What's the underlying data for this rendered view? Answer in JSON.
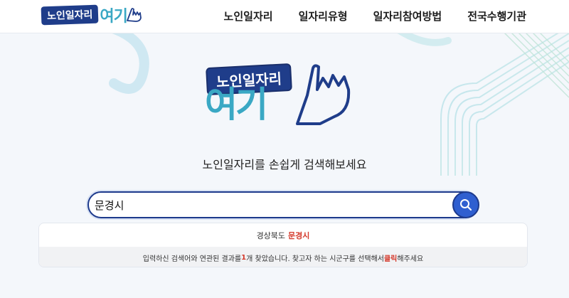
{
  "header": {
    "logo_pill": "노인일자리",
    "logo_big": "여기",
    "nav": [
      "노인일자리",
      "일자리유형",
      "일자리참여방법",
      "전국수행기관"
    ]
  },
  "hero": {
    "logo_pill": "노인일자리",
    "logo_big": "여기",
    "subtitle": "노인일자리를 손쉽게 검색해보세요"
  },
  "search": {
    "value": "문경시",
    "placeholder": ""
  },
  "result": {
    "province": "경상북도",
    "city": "문경시",
    "msg_before": "입력하신 검색어와 연관된 결과를 ",
    "count": "1",
    "msg_middle": "개 찾았습니다. 찾고자 하는 시군구를 선택해서 ",
    "click_word": "클릭",
    "msg_after": "해주세요"
  },
  "colors": {
    "brand_navy": "#1f3d8a",
    "brand_teal": "#3aa8c4",
    "search_blue": "#2f5fd0",
    "highlight_red": "#d43a2c"
  }
}
